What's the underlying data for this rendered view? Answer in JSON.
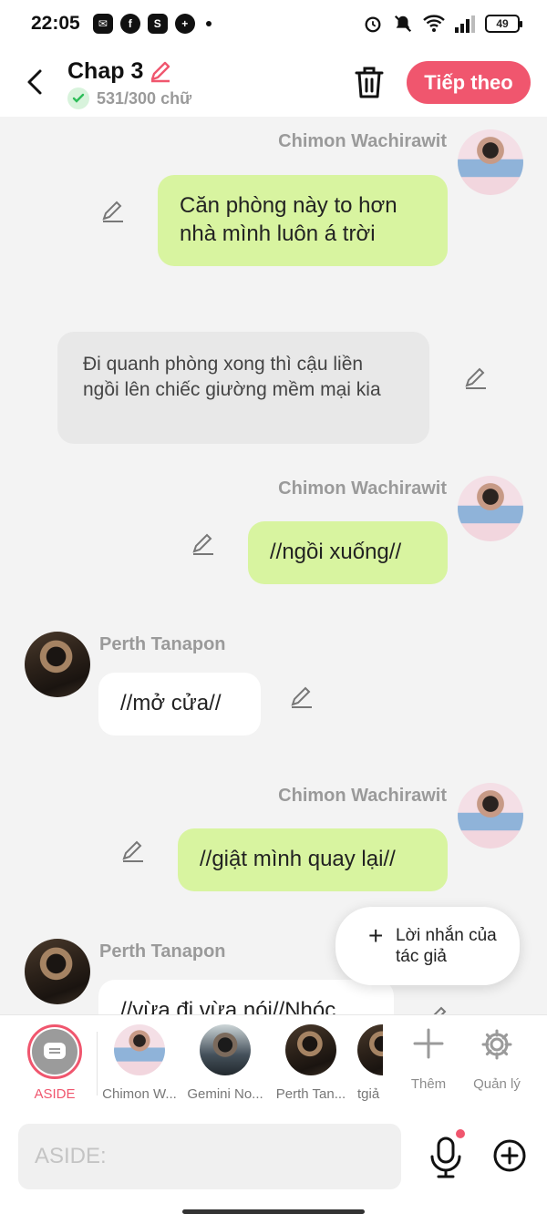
{
  "status_bar": {
    "time": "22:05",
    "battery": "49"
  },
  "header": {
    "title": "Chap 3",
    "word_count": "531/300 chữ",
    "next_label": "Tiếp theo"
  },
  "messages": [
    {
      "sender": "Chimon Wachirawit",
      "text": "Căn phòng này to hơn nhà mình luôn á trời"
    },
    {
      "text": "Đi quanh phòng xong thì cậu liền ngồi lên chiếc giường mềm mại kia"
    },
    {
      "sender": "Chimon Wachirawit",
      "text": "//ngồi xuống//"
    },
    {
      "sender": "Perth Tanapon",
      "text": "//mở cửa//"
    },
    {
      "sender": "Chimon Wachirawit",
      "text": "//giật mình quay lại//"
    },
    {
      "sender": "Perth Tanapon",
      "text": "//vừa đi vừa nói//Nhóc"
    }
  ],
  "author_note": {
    "label": "Lời nhắn của tác giả"
  },
  "character_bar": {
    "aside_label": "ASIDE",
    "characters": [
      "Chimon W...",
      "Gemini No...",
      "Perth Tan...",
      "tgiả"
    ],
    "add_label": "Thêm",
    "manage_label": "Quản lý"
  },
  "input": {
    "placeholder": "ASIDE:"
  },
  "colors": {
    "accent": "#f0566e",
    "bubble_green": "#d8f4a0",
    "check_green": "#2ebd59"
  }
}
